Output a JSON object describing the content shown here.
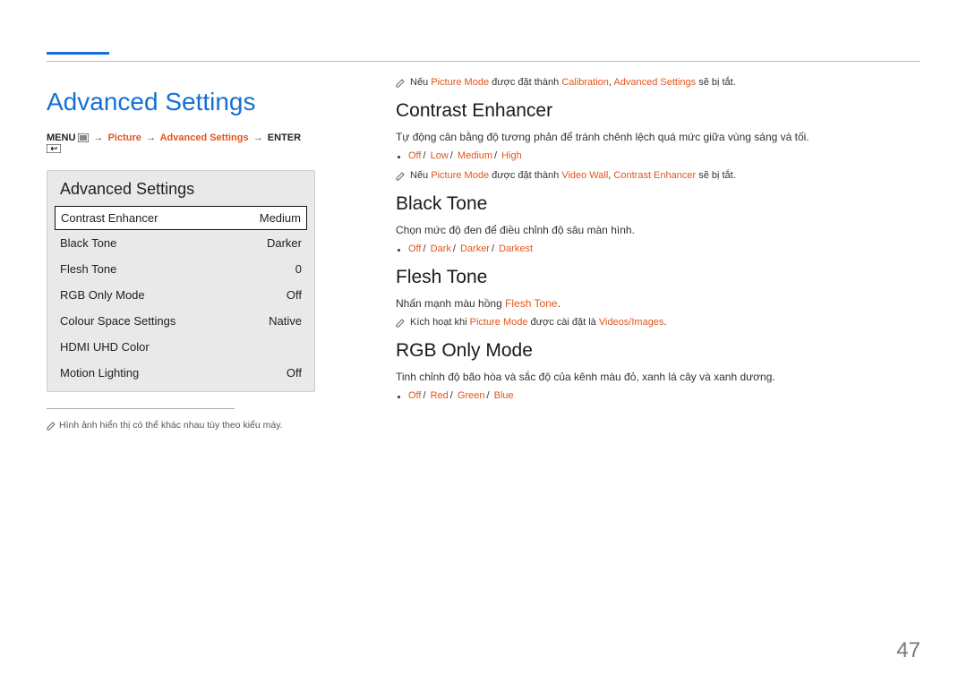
{
  "title": "Advanced Settings",
  "breadcrumb": {
    "menu": "MENU",
    "picture": "Picture",
    "advanced": "Advanced Settings",
    "enter": "ENTER"
  },
  "panel": {
    "title": "Advanced Settings",
    "rows": [
      {
        "label": "Contrast Enhancer",
        "value": "Medium"
      },
      {
        "label": "Black Tone",
        "value": "Darker"
      },
      {
        "label": "Flesh Tone",
        "value": "0"
      },
      {
        "label": "RGB Only Mode",
        "value": "Off"
      },
      {
        "label": "Colour Space Settings",
        "value": "Native"
      },
      {
        "label": "HDMI UHD Color",
        "value": ""
      },
      {
        "label": "Motion Lighting",
        "value": "Off"
      }
    ]
  },
  "footnote": "Hình ảnh hiển thị có thể khác nhau tùy theo kiểu máy.",
  "note1": {
    "pre": "Nếu ",
    "pm": "Picture Mode",
    "mid": " được đặt thành ",
    "cal": "Calibration",
    "sep": ", ",
    "as": "Advanced Settings",
    "post": " sẽ bị tắt."
  },
  "sections": {
    "contrast": {
      "heading": "Contrast Enhancer",
      "desc": "Tự động cân bằng độ tương phản để tránh chênh lệch quá mức giữa vùng sáng và tối.",
      "opts": [
        "Off",
        "Low",
        "Medium",
        "High"
      ],
      "note": {
        "pre": "Nếu ",
        "pm": "Picture Mode",
        "mid": " được đặt thành ",
        "vw": "Video Wall",
        "sep": ", ",
        "ce": "Contrast Enhancer",
        "post": " sẽ bị tắt."
      }
    },
    "blacktone": {
      "heading": "Black Tone",
      "desc": "Chọn mức độ đen để điều chỉnh độ sâu màn hình.",
      "opts": [
        "Off",
        "Dark",
        "Darker",
        "Darkest"
      ]
    },
    "fleshtone": {
      "heading": "Flesh Tone",
      "desc_pre": "Nhấn mạnh màu hồng ",
      "desc_ft": "Flesh Tone",
      "desc_post": ".",
      "note": {
        "pre": "Kích hoạt khi ",
        "pm": "Picture Mode",
        "mid": " được cài đặt là ",
        "vi": "Videos/Images",
        "post": "."
      }
    },
    "rgbonly": {
      "heading": "RGB Only Mode",
      "desc": "Tinh chỉnh độ bão hòa và sắc độ của kênh màu đỏ, xanh lá cây và xanh dương.",
      "opts": [
        "Off",
        "Red",
        "Green",
        "Blue"
      ]
    }
  },
  "page": "47"
}
